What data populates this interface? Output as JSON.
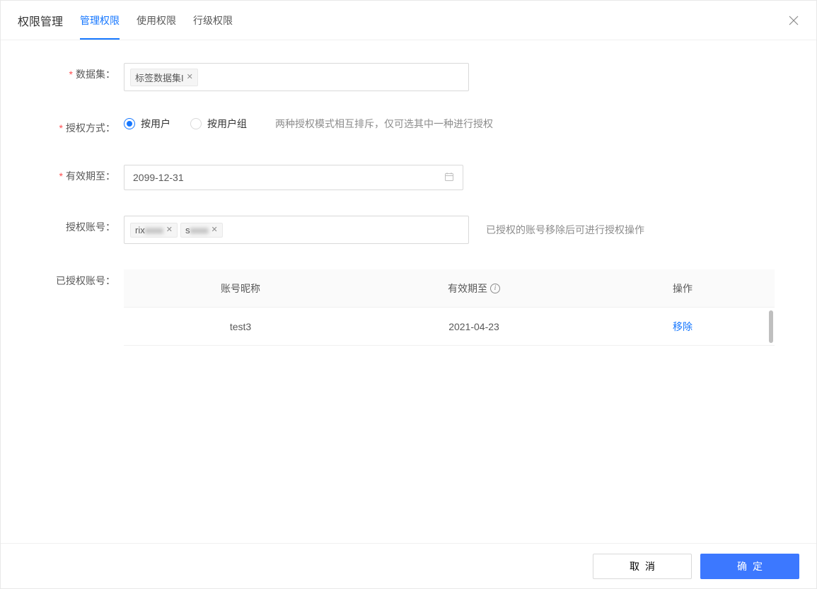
{
  "dialog": {
    "title": "权限管理",
    "tabs": [
      {
        "label": "管理权限",
        "active": true
      },
      {
        "label": "使用权限",
        "active": false
      },
      {
        "label": "行级权限",
        "active": false
      }
    ]
  },
  "form": {
    "dataset": {
      "label": "数据集：",
      "tags": [
        "标签数据集I"
      ]
    },
    "auth_method": {
      "label": "授权方式：",
      "options": [
        {
          "label": "按用户",
          "checked": true
        },
        {
          "label": "按用户组",
          "checked": false
        }
      ],
      "hint": "两种授权模式相互排斥，仅可选其中一种进行授权"
    },
    "valid_until": {
      "label": "有效期至：",
      "value": "2099-12-31"
    },
    "auth_account": {
      "label": "授权账号：",
      "tags": [
        {
          "prefix": "rix",
          "masked": "xxxx"
        },
        {
          "prefix": "s",
          "masked": "xxxx"
        }
      ],
      "hint": "已授权的账号移除后可进行授权操作"
    },
    "authorized_account": {
      "label": "已授权账号："
    }
  },
  "table": {
    "columns": [
      "账号昵称",
      "有效期至",
      "操作"
    ],
    "rows": [
      {
        "nickname": "test3",
        "valid_until": "2021-04-23",
        "action": "移除"
      }
    ]
  },
  "footer": {
    "cancel": "取消",
    "confirm": "确定"
  }
}
